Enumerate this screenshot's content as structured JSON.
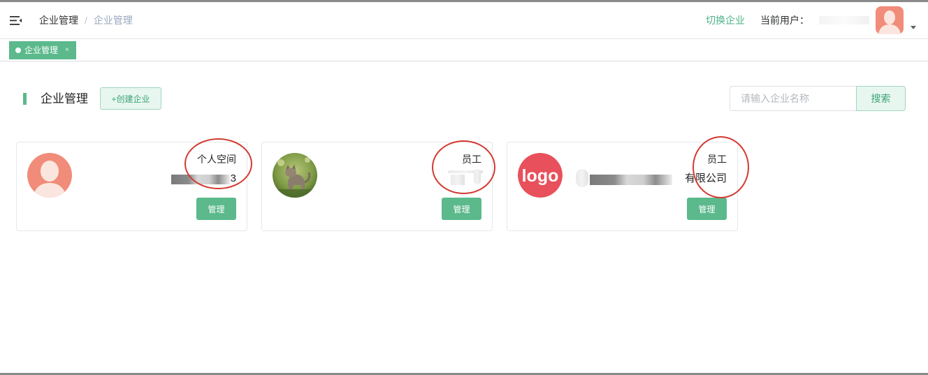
{
  "header": {
    "breadcrumb": [
      "企业管理",
      "企业管理"
    ],
    "breadcrumb_sep": "/",
    "switch_label": "切换企业",
    "user_label": "当前用户："
  },
  "tags": [
    {
      "label": "企业管理",
      "close": "×"
    }
  ],
  "page": {
    "title": "企业管理",
    "create_label": "+创建企业",
    "search_placeholder": "请输入企业名称",
    "search_label": "搜索"
  },
  "cards": [
    {
      "role": "个人空间",
      "name_visible": "3",
      "manage_label": "管理",
      "avatar": "default-avatar-icon"
    },
    {
      "role": "员工",
      "name_visible": "",
      "manage_label": "管理",
      "avatar": "cat-photo"
    },
    {
      "role": "员工",
      "name_visible": "有限公司",
      "manage_label": "管理",
      "avatar": "logo-badge",
      "logo_text": "logo"
    }
  ],
  "colors": {
    "accent": "#5bb98c",
    "accent_light": "#e8f6f0",
    "link": "#4db38a",
    "annotation": "#d23a31",
    "logo_red": "#e8505b",
    "avatar_salmon": "#f08c79"
  }
}
